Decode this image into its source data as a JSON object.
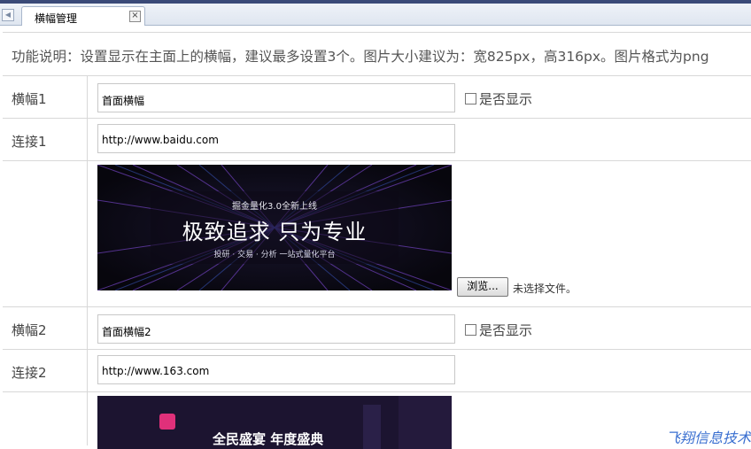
{
  "tab": {
    "title": "横幅管理",
    "close": "×",
    "left_arrow": "◀"
  },
  "description": "功能说明：设置显示在主面上的横幅，建议最多设置3个。图片大小建议为：宽825px，高316px。图片格式为png",
  "banners": [
    {
      "label": "横幅1",
      "title_value": "首面横幅",
      "show_label": "是否显示",
      "show_checked": false,
      "link_label": "连接1",
      "link_value": "http://www.baidu.com",
      "image_texts": [
        "掘金量化3.0全新上线",
        "极致追求  只为专业",
        "投研 · 交易 · 分析 一站式量化平台"
      ]
    },
    {
      "label": "横幅2",
      "title_value": "首面横幅2",
      "show_label": "是否显示",
      "show_checked": false,
      "link_label": "连接2",
      "link_value": "http://www.163.com",
      "image_texts": [
        "全民盛宴 年度盛典"
      ]
    }
  ],
  "upload": {
    "browse_label": "浏览...",
    "no_file": "未选择文件。"
  },
  "watermark": "飞翔信息技术",
  "colors": {
    "tab_bar": "#3a4a78",
    "border": "#d8d8d8",
    "watermark": "#3a6fd0"
  }
}
